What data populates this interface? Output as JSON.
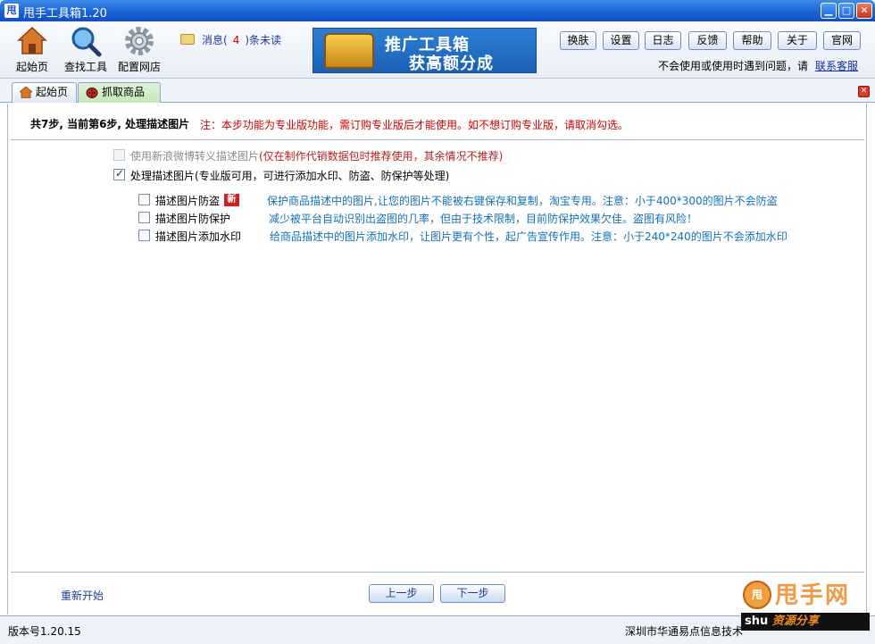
{
  "window": {
    "title": "甩手工具箱1.20",
    "app_icon": "甩",
    "minimize": "▁",
    "restore": "□",
    "close": "✕"
  },
  "toolbar": {
    "home_label": "起始页",
    "find_tools_label": "查找工具",
    "config_store_label": "配置网店",
    "message_prefix": "消息(",
    "message_count": "4",
    "message_suffix": ")条未读",
    "banner_line1": "推广工具箱",
    "banner_line2": "获高额分成",
    "buttons": [
      "换肤",
      "设置",
      "日志",
      "反馈",
      "帮助",
      "关于",
      "官网"
    ],
    "help_text": "不会使用或使用时遇到问题，请",
    "contact_link": "联系客服"
  },
  "tabs": [
    {
      "label": "起始页",
      "icon": "home-icon"
    },
    {
      "label": "抓取商品",
      "icon": "ladybug-icon"
    }
  ],
  "step": {
    "title": "共7步, 当前第6步, 处理描述图片",
    "note": "注：本步功能为专业版功能，需订购专业版后才能使用。如不想订购专业版，请取消勾选。"
  },
  "options": {
    "weibo": {
      "label": "使用新浪微博转义描述图片",
      "hint": "(仅在制作代销数据包时推荐使用，其余情况不推荐)",
      "checked": false,
      "disabled": true
    },
    "process": {
      "label": "处理描述图片(专业版可用，可进行添加水印、防盗、防保护等处理)",
      "checked": true
    },
    "sub": [
      {
        "label": "描述图片防盗",
        "badge": "新",
        "desc": "保护商品描述中的图片,让您的图片不能被右键保存和复制，淘宝专用。注意：小于400*300的图片不会防盗"
      },
      {
        "label": "描述图片防保护",
        "desc": "减少被平台自动识别出盗图的几率，但由于技术限制，目前防保护效果欠佳。盗图有风险！"
      },
      {
        "label": "描述图片添加水印",
        "desc": "给商品描述中的图片添加水印，让图片更有个性，起广告宣传作用。注意：小于240*240的图片不会添加水印"
      }
    ]
  },
  "footer": {
    "restart": "重新开始",
    "prev": "上一步",
    "next": "下一步",
    "version": "版本号1.20.15",
    "company": "深圳市华通易点信息技术"
  },
  "watermark": {
    "face": "甩",
    "title": "甩手网",
    "bar_text": "shu",
    "bar_site": "资源分享"
  }
}
